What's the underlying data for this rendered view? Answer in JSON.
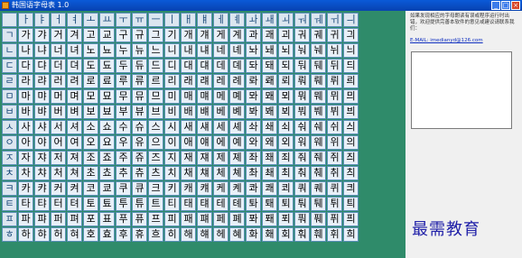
{
  "window": {
    "title": "韩国语字母表 1.0",
    "minimize": "_",
    "maximize": "□",
    "close": "×"
  },
  "grid": {
    "vowels": [
      "ㅏ",
      "ㅑ",
      "ㅓ",
      "ㅕ",
      "ㅗ",
      "ㅛ",
      "ㅜ",
      "ㅠ",
      "ㅡ",
      "ㅣ",
      "ㅐ",
      "ㅒ",
      "ㅔ",
      "ㅖ",
      "ㅘ",
      "ㅙ",
      "ㅚ",
      "ㅝ",
      "ㅞ",
      "ㅟ",
      "ㅢ"
    ],
    "consonants": [
      "ㄱ",
      "ㄴ",
      "ㄷ",
      "ㄹ",
      "ㅁ",
      "ㅂ",
      "ㅅ",
      "ㅇ",
      "ㅈ",
      "ㅊ",
      "ㅋ",
      "ㅌ",
      "ㅍ",
      "ㅎ"
    ],
    "rows": [
      [
        "가",
        "갸",
        "거",
        "겨",
        "고",
        "교",
        "구",
        "규",
        "그",
        "기",
        "개",
        "걔",
        "게",
        "계",
        "과",
        "괘",
        "괴",
        "궈",
        "궤",
        "귀",
        "긔"
      ],
      [
        "나",
        "냐",
        "너",
        "녀",
        "노",
        "뇨",
        "누",
        "뉴",
        "느",
        "니",
        "내",
        "냬",
        "네",
        "녜",
        "놔",
        "놰",
        "뇌",
        "눠",
        "눼",
        "뉘",
        "늬"
      ],
      [
        "다",
        "댜",
        "더",
        "뎌",
        "도",
        "됴",
        "두",
        "듀",
        "드",
        "디",
        "대",
        "댸",
        "데",
        "뎨",
        "돠",
        "돼",
        "되",
        "둬",
        "뒈",
        "뒤",
        "듸"
      ],
      [
        "라",
        "랴",
        "러",
        "려",
        "로",
        "료",
        "루",
        "류",
        "르",
        "리",
        "래",
        "럐",
        "레",
        "례",
        "롸",
        "뢔",
        "뢰",
        "뤄",
        "뤠",
        "뤼",
        "릐"
      ],
      [
        "마",
        "먀",
        "머",
        "며",
        "모",
        "묘",
        "무",
        "뮤",
        "므",
        "미",
        "매",
        "먜",
        "메",
        "몌",
        "뫄",
        "뫠",
        "뫼",
        "뭐",
        "뭬",
        "뮈",
        "믜"
      ],
      [
        "바",
        "뱌",
        "버",
        "벼",
        "보",
        "뵤",
        "부",
        "뷰",
        "브",
        "비",
        "배",
        "뱨",
        "베",
        "볘",
        "봐",
        "봬",
        "뵈",
        "붜",
        "붸",
        "뷔",
        "븨"
      ],
      [
        "사",
        "샤",
        "서",
        "셔",
        "소",
        "쇼",
        "수",
        "슈",
        "스",
        "시",
        "새",
        "섀",
        "세",
        "셰",
        "솨",
        "쇄",
        "쇠",
        "숴",
        "쉐",
        "쉬",
        "싀"
      ],
      [
        "아",
        "야",
        "어",
        "여",
        "오",
        "요",
        "우",
        "유",
        "으",
        "이",
        "애",
        "얘",
        "에",
        "예",
        "와",
        "왜",
        "외",
        "워",
        "웨",
        "위",
        "의"
      ],
      [
        "자",
        "쟈",
        "저",
        "져",
        "조",
        "죠",
        "주",
        "쥬",
        "즈",
        "지",
        "재",
        "쟤",
        "제",
        "졔",
        "좌",
        "좨",
        "죄",
        "줘",
        "줴",
        "쥐",
        "즤"
      ],
      [
        "차",
        "챠",
        "처",
        "쳐",
        "초",
        "쵸",
        "추",
        "츄",
        "츠",
        "치",
        "채",
        "챼",
        "체",
        "쳬",
        "촤",
        "쵀",
        "최",
        "춰",
        "췌",
        "취",
        "츼"
      ],
      [
        "카",
        "캬",
        "커",
        "켜",
        "코",
        "쿄",
        "쿠",
        "큐",
        "크",
        "키",
        "캐",
        "컈",
        "케",
        "켸",
        "콰",
        "쾌",
        "쾨",
        "쿼",
        "퀘",
        "퀴",
        "킈"
      ],
      [
        "타",
        "탸",
        "터",
        "텨",
        "토",
        "툐",
        "투",
        "튜",
        "트",
        "티",
        "태",
        "턔",
        "테",
        "톄",
        "톼",
        "퇘",
        "퇴",
        "퉈",
        "퉤",
        "튀",
        "틔"
      ],
      [
        "파",
        "퍄",
        "퍼",
        "펴",
        "포",
        "표",
        "푸",
        "퓨",
        "프",
        "피",
        "패",
        "퍠",
        "페",
        "폐",
        "퐈",
        "퐤",
        "푀",
        "풔",
        "풰",
        "퓌",
        "픠"
      ],
      [
        "하",
        "햐",
        "허",
        "혀",
        "호",
        "효",
        "후",
        "휴",
        "흐",
        "히",
        "해",
        "햬",
        "헤",
        "혜",
        "화",
        "홰",
        "회",
        "훠",
        "훼",
        "휘",
        "희"
      ]
    ]
  },
  "sidebar": {
    "note": "如果发现相应的字母朗读有误或程序运行时出错，欢迎提供完善本软件的意见或建议请联系我们：",
    "email": "E-MAIL: imedianyd@126.com"
  },
  "watermark": "最需教育"
}
